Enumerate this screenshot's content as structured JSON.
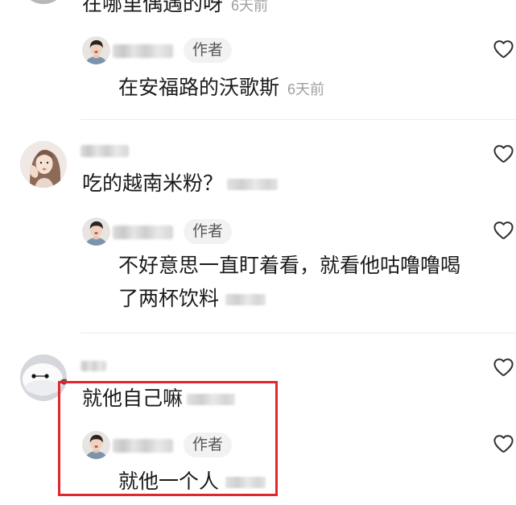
{
  "theme": {
    "text_color": "#1a1a1a",
    "muted_color": "#9f9f9f",
    "badge_bg": "#f2f2f2",
    "badge_text": "#565656",
    "divider": "#ececec",
    "highlight": "#e3262b",
    "icon_color": "#303030"
  },
  "icons": {
    "like": "heart-outline-icon"
  },
  "comments": [
    {
      "text": "在哪里偶遇的呀",
      "time": "6天前",
      "replies": [
        {
          "badge": "作者",
          "text": "在安福路的沃歌斯",
          "time": "6天前"
        }
      ]
    },
    {
      "text": "吃的越南米粉？",
      "replies": [
        {
          "badge": "作者",
          "text": "不好意思一直盯着看，就看他咕噜噜喝了两杯饮料"
        }
      ]
    },
    {
      "text": "就他自己嘛",
      "replies": [
        {
          "badge": "作者",
          "text": "就他一个人"
        }
      ]
    }
  ]
}
